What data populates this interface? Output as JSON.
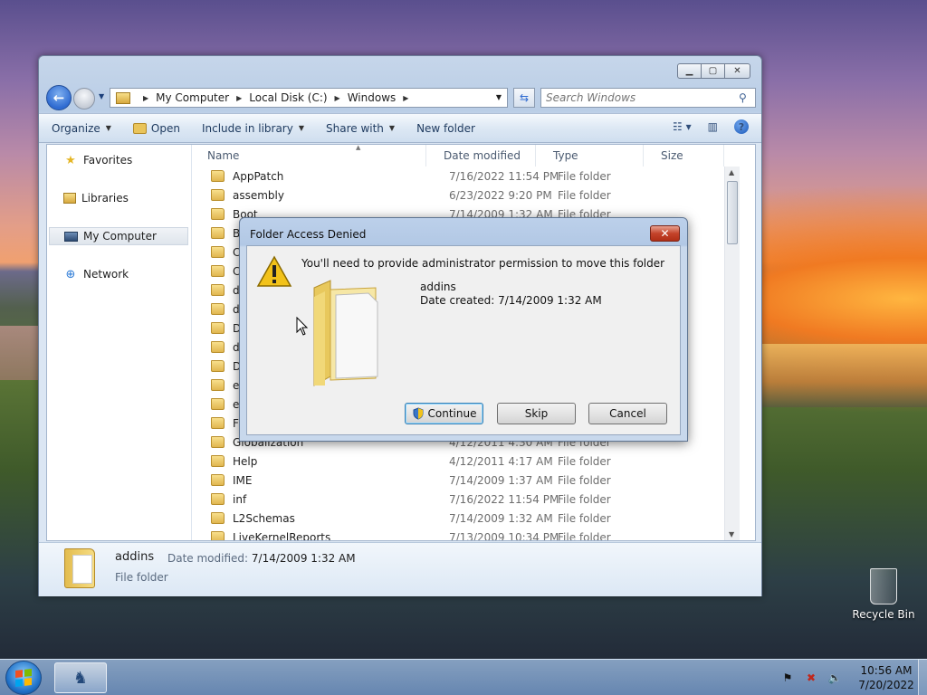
{
  "explorer": {
    "breadcrumb": [
      "My Computer",
      "Local Disk (C:)",
      "Windows"
    ],
    "search_placeholder": "Search Windows",
    "toolbar": {
      "organize": "Organize",
      "open": "Open",
      "include_in_library": "Include in library",
      "share_with": "Share with",
      "new_folder": "New folder"
    },
    "nav": [
      "Favorites",
      "Libraries",
      "My Computer",
      "Network"
    ],
    "columns": [
      "Name",
      "Date modified",
      "Type",
      "Size"
    ],
    "rows": [
      {
        "name": "AppPatch",
        "date": "7/16/2022 11:54 PM",
        "type": "File folder"
      },
      {
        "name": "assembly",
        "date": "6/23/2022 9:20 PM",
        "type": "File folder"
      },
      {
        "name": "Boot",
        "date": "7/14/2009 1:32 AM",
        "type": "File folder"
      },
      {
        "name": "Bra",
        "date": "",
        "type": ""
      },
      {
        "name": "CSC",
        "date": "",
        "type": ""
      },
      {
        "name": "Cu",
        "date": "",
        "type": ""
      },
      {
        "name": "deb",
        "date": "",
        "type": ""
      },
      {
        "name": "dia",
        "date": "",
        "type": ""
      },
      {
        "name": "Dig",
        "date": "",
        "type": ""
      },
      {
        "name": "dot",
        "date": "",
        "type": ""
      },
      {
        "name": "Do",
        "date": "",
        "type": ""
      },
      {
        "name": "eho",
        "date": "",
        "type": ""
      },
      {
        "name": "en-",
        "date": "",
        "type": ""
      },
      {
        "name": "For",
        "date": "",
        "type": ""
      },
      {
        "name": "Globalization",
        "date": "4/12/2011 4:30 AM",
        "type": "File folder"
      },
      {
        "name": "Help",
        "date": "4/12/2011 4:17 AM",
        "type": "File folder"
      },
      {
        "name": "IME",
        "date": "7/14/2009 1:37 AM",
        "type": "File folder"
      },
      {
        "name": "inf",
        "date": "7/16/2022 11:54 PM",
        "type": "File folder"
      },
      {
        "name": "L2Schemas",
        "date": "7/14/2009 1:32 AM",
        "type": "File folder"
      },
      {
        "name": "LiveKernelReports",
        "date": "7/13/2009 10:34 PM",
        "type": "File folder"
      }
    ],
    "details": {
      "name": "addins",
      "modified_label": "Date modified:",
      "modified_value": "7/14/2009 1:32 AM",
      "type": "File folder"
    }
  },
  "dialog": {
    "title": "Folder Access Denied",
    "message": "You'll need to provide administrator permission to move this folder",
    "folder_name": "addins",
    "date_created": "Date created: 7/14/2009 1:32 AM",
    "continue": "Continue",
    "skip": "Skip",
    "cancel": "Cancel"
  },
  "desktop": {
    "recycle_bin": "Recycle Bin"
  },
  "taskbar": {
    "time": "10:56 AM",
    "date": "7/20/2022"
  },
  "colors": {
    "accent": "#2f6bd1",
    "close_red": "#c4432a",
    "folder_yellow": "#e0b650"
  }
}
